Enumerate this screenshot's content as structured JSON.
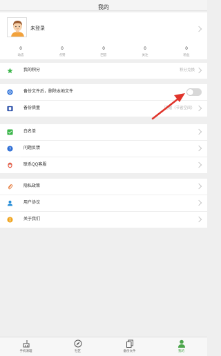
{
  "header": {
    "title": "我的"
  },
  "profile": {
    "login_text": "未登录",
    "stats": [
      {
        "value": "0",
        "label": "动态"
      },
      {
        "value": "0",
        "label": "点赞"
      },
      {
        "value": "0",
        "label": "回答"
      },
      {
        "value": "0",
        "label": "关注"
      },
      {
        "value": "0",
        "label": "粉丝"
      }
    ]
  },
  "points": {
    "label": "我的积分",
    "extra": "积分兑换"
  },
  "backup": {
    "delete_label": "备份文件后，删除本地文件",
    "delete_toggle_on": false,
    "quality_label": "备份质量",
    "quality_extra": "压缩（节省空间）"
  },
  "menu1": [
    {
      "label": "白名单",
      "icon": "whitelist-icon",
      "color": "#3bb54a"
    },
    {
      "label": "问题反馈",
      "icon": "question-icon",
      "color": "#2f6fd6"
    },
    {
      "label": "联系QQ客服",
      "icon": "qq-icon",
      "color": "#e8563f"
    }
  ],
  "menu2": [
    {
      "label": "隐私政策",
      "icon": "paperclip-icon",
      "color": "#e57a3c"
    },
    {
      "label": "用户协议",
      "icon": "user-icon",
      "color": "#2a8fd8"
    },
    {
      "label": "关于我们",
      "icon": "info-icon",
      "color": "#f0a51f"
    }
  ],
  "tabs": [
    {
      "label": "手机清理",
      "icon": "broom-icon",
      "active": false
    },
    {
      "label": "社区",
      "icon": "compass-icon",
      "active": false
    },
    {
      "label": "备份文件",
      "icon": "files-icon",
      "active": false
    },
    {
      "label": "我的",
      "icon": "person-icon",
      "active": true
    }
  ],
  "colors": {
    "accent": "#4ba54b",
    "arrow": "#e0342b"
  }
}
